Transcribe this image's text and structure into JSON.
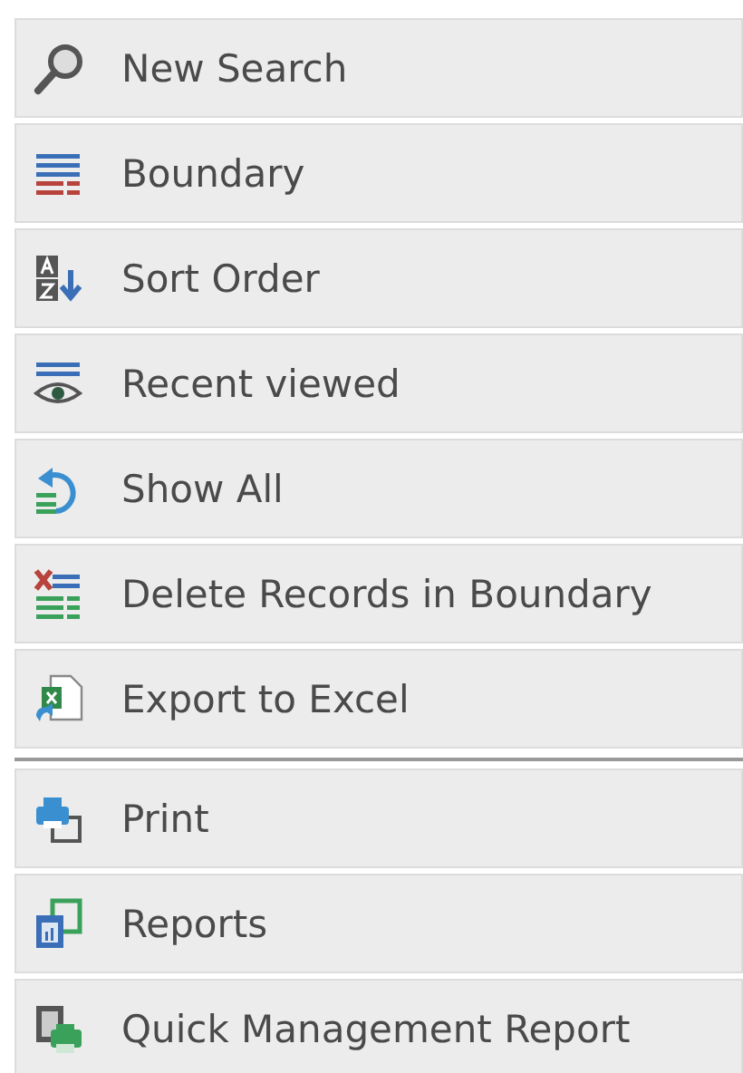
{
  "menu_groups": [
    {
      "items": [
        {
          "label": "New Search"
        },
        {
          "label": "Boundary"
        },
        {
          "label": "Sort Order"
        },
        {
          "label": "Recent viewed"
        },
        {
          "label": "Show All"
        },
        {
          "label": "Delete Records in Boundary"
        },
        {
          "label": "Export to Excel"
        }
      ]
    },
    {
      "items": [
        {
          "label": "Print"
        },
        {
          "label": "Reports"
        },
        {
          "label": "Quick Management Report"
        }
      ]
    }
  ]
}
